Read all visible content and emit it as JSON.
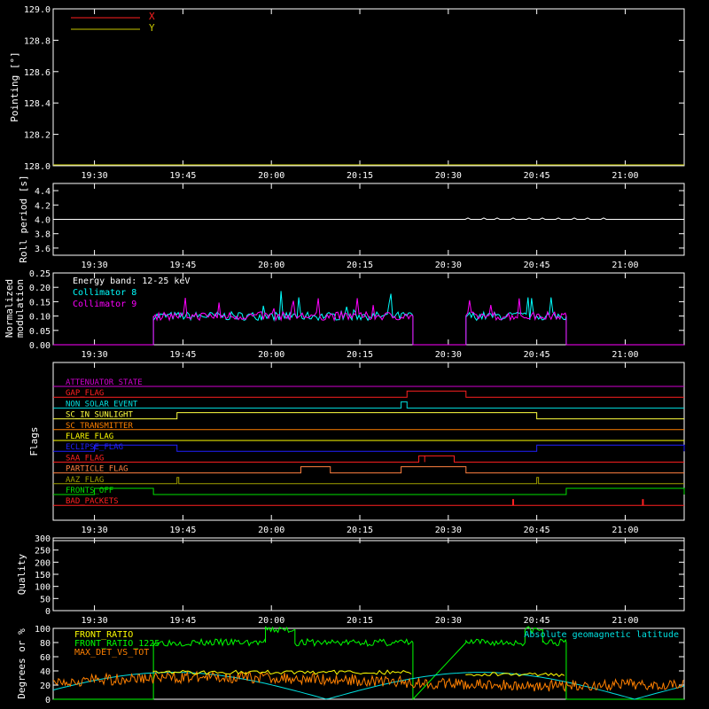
{
  "time_ticks": [
    "19:30",
    "19:45",
    "20:00",
    "20:15",
    "20:30",
    "20:45",
    "21:00"
  ],
  "chart_data": [
    {
      "type": "line",
      "ylabel": "Pointing [°]",
      "ylim": [
        128.0,
        129.0
      ],
      "yticks": [
        "128.0",
        "128.2",
        "128.4",
        "128.6",
        "128.8",
        "129.0"
      ],
      "legend": [
        {
          "name": "X",
          "color": "#ff2020"
        },
        {
          "name": "Y",
          "color": "#c8c800"
        }
      ],
      "series": [
        {
          "name": "Y",
          "color": "#c8c800",
          "x": [
            "19:30",
            "21:10"
          ],
          "values": [
            128.0,
            128.0
          ]
        }
      ]
    },
    {
      "type": "line",
      "ylabel": "Roll period [s]",
      "ylim": [
        3.5,
        4.5
      ],
      "yticks": [
        "3.6",
        "3.8",
        "4.0",
        "4.2",
        "4.4"
      ],
      "series": [
        {
          "name": "roll",
          "color": "#ffffff",
          "x": [
            "19:30",
            "21:10"
          ],
          "values": [
            4.0,
            4.0
          ]
        }
      ]
    },
    {
      "type": "line",
      "ylabel": "Normalized modulation",
      "ylim": [
        0,
        0.25
      ],
      "yticks": [
        "0.00",
        "0.05",
        "0.10",
        "0.15",
        "0.20",
        "0.25"
      ],
      "annotation": "Energy band: 12-25 keV",
      "legend": [
        {
          "name": "Collimator 8",
          "color": "#00ffff"
        },
        {
          "name": "Collimator 9",
          "color": "#ff00ff"
        }
      ],
      "segments": [
        [
          "19:40",
          "20:24"
        ],
        [
          "20:33",
          "20:50"
        ]
      ],
      "baseline": 0.1
    },
    {
      "type": "line",
      "ylabel": "Flags",
      "flags": [
        {
          "name": "ATTENUATOR_STATE",
          "color": "#d000d0",
          "steps": []
        },
        {
          "name": "GAP_FLAG",
          "color": "#ff2020",
          "steps": [
            [
              "20:23",
              "20:33"
            ]
          ]
        },
        {
          "name": "NON_SOLAR_EVENT",
          "color": "#00e0e0",
          "steps": [
            [
              "20:22",
              "20:23"
            ]
          ]
        },
        {
          "name": "SC_IN_SUNLIGHT",
          "color": "#ffff40",
          "steps": [
            [
              "19:44",
              "20:45"
            ]
          ]
        },
        {
          "name": "SC_TRANSMITTER",
          "color": "#ff8000",
          "steps": []
        },
        {
          "name": "FLARE_FLAG",
          "color": "#ffff00",
          "steps": []
        },
        {
          "name": "ECLIPSE_FLAG",
          "color": "#2020ff",
          "steps": [
            [
              "19:30",
              "19:44"
            ],
            [
              "20:45",
              "21:10"
            ]
          ]
        },
        {
          "name": "SAA_FLAG",
          "color": "#ff2020",
          "steps": [
            [
              "20:25",
              "20:26"
            ],
            [
              "20:26",
              "20:31"
            ]
          ]
        },
        {
          "name": "PARTICLE_FLAG",
          "color": "#ff8040",
          "steps": [
            [
              "20:05",
              "20:10"
            ],
            [
              "20:22",
              "20:33"
            ]
          ]
        },
        {
          "name": "AAZ_FLAG",
          "color": "#a0a000",
          "steps": [
            [
              "19:44",
              "19:44"
            ],
            [
              "20:45",
              "20:45"
            ]
          ]
        },
        {
          "name": "FRONTS_OFF",
          "color": "#00e000",
          "steps": [
            [
              "19:30",
              "19:40"
            ],
            [
              "20:50",
              "21:10"
            ]
          ]
        },
        {
          "name": "BAD_PACKETS",
          "color": "#ff2020",
          "spikes": [
            "20:41",
            "21:03"
          ]
        }
      ]
    },
    {
      "type": "line",
      "ylabel": "Quality",
      "ylim": [
        0,
        300
      ],
      "yticks": [
        "0",
        "50",
        "100",
        "150",
        "200",
        "250",
        "300"
      ],
      "series": [
        {
          "name": "quality",
          "color": "#ffffff",
          "x": [
            "19:30",
            "21:10"
          ],
          "values": [
            300,
            300
          ]
        }
      ]
    },
    {
      "type": "line",
      "ylabel": "Degrees or %",
      "ylim": [
        0,
        100
      ],
      "yticks": [
        "0",
        "20",
        "40",
        "60",
        "80",
        "100"
      ],
      "legend": [
        {
          "name": "FRONT_RATIO",
          "color": "#ffff00"
        },
        {
          "name": "FRONT_RATIO_1225",
          "color": "#00ff00"
        },
        {
          "name": "MAX_DET_VS_TOT",
          "color": "#ff8000"
        }
      ],
      "legend_right": {
        "name": "Absolute geomagnetic latitude",
        "color": "#00e0e0"
      }
    }
  ]
}
